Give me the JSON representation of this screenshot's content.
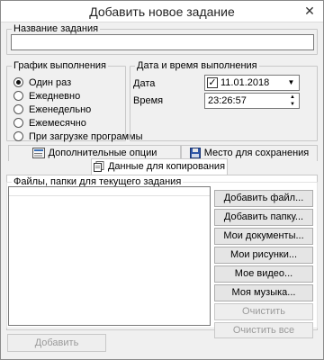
{
  "window": {
    "title": "Добавить новое задание",
    "close_glyph": "✕"
  },
  "task_name": {
    "legend": "Название задания",
    "value": ""
  },
  "schedule": {
    "legend": "График выполнения",
    "options": [
      {
        "label": "Один раз",
        "selected": true
      },
      {
        "label": "Ежедневно",
        "selected": false
      },
      {
        "label": "Еженедельно",
        "selected": false
      },
      {
        "label": "Ежемесячно",
        "selected": false
      },
      {
        "label": "При загрузке программы",
        "selected": false
      }
    ]
  },
  "datetime": {
    "legend": "Дата и время выполнения",
    "date_label": "Дата",
    "date_value": "11.01.2018",
    "date_checked": true,
    "time_label": "Время",
    "time_value": "23:26:57"
  },
  "tabs": {
    "extra_options": "Дополнительные опции",
    "save_location": "Место для сохранения",
    "copy_data": "Данные для копирования",
    "active": "copy_data"
  },
  "files": {
    "legend": "Файлы, папки для текущего задания",
    "items": [],
    "buttons": [
      {
        "label": "Добавить файл...",
        "enabled": true
      },
      {
        "label": "Добавить папку...",
        "enabled": true
      },
      {
        "label": "Мои документы...",
        "enabled": true
      },
      {
        "label": "Мои рисунки...",
        "enabled": true
      },
      {
        "label": "Мое видео...",
        "enabled": true
      },
      {
        "label": "Моя музыка...",
        "enabled": true
      },
      {
        "label": "Очистить",
        "enabled": false
      },
      {
        "label": "Очистить все",
        "enabled": false
      }
    ]
  },
  "footer": {
    "add_label": "Добавить",
    "add_enabled": false
  },
  "icons": {
    "extra_options": "options-icon",
    "save_location": "save-icon",
    "copy_data": "copy-data-icon"
  }
}
